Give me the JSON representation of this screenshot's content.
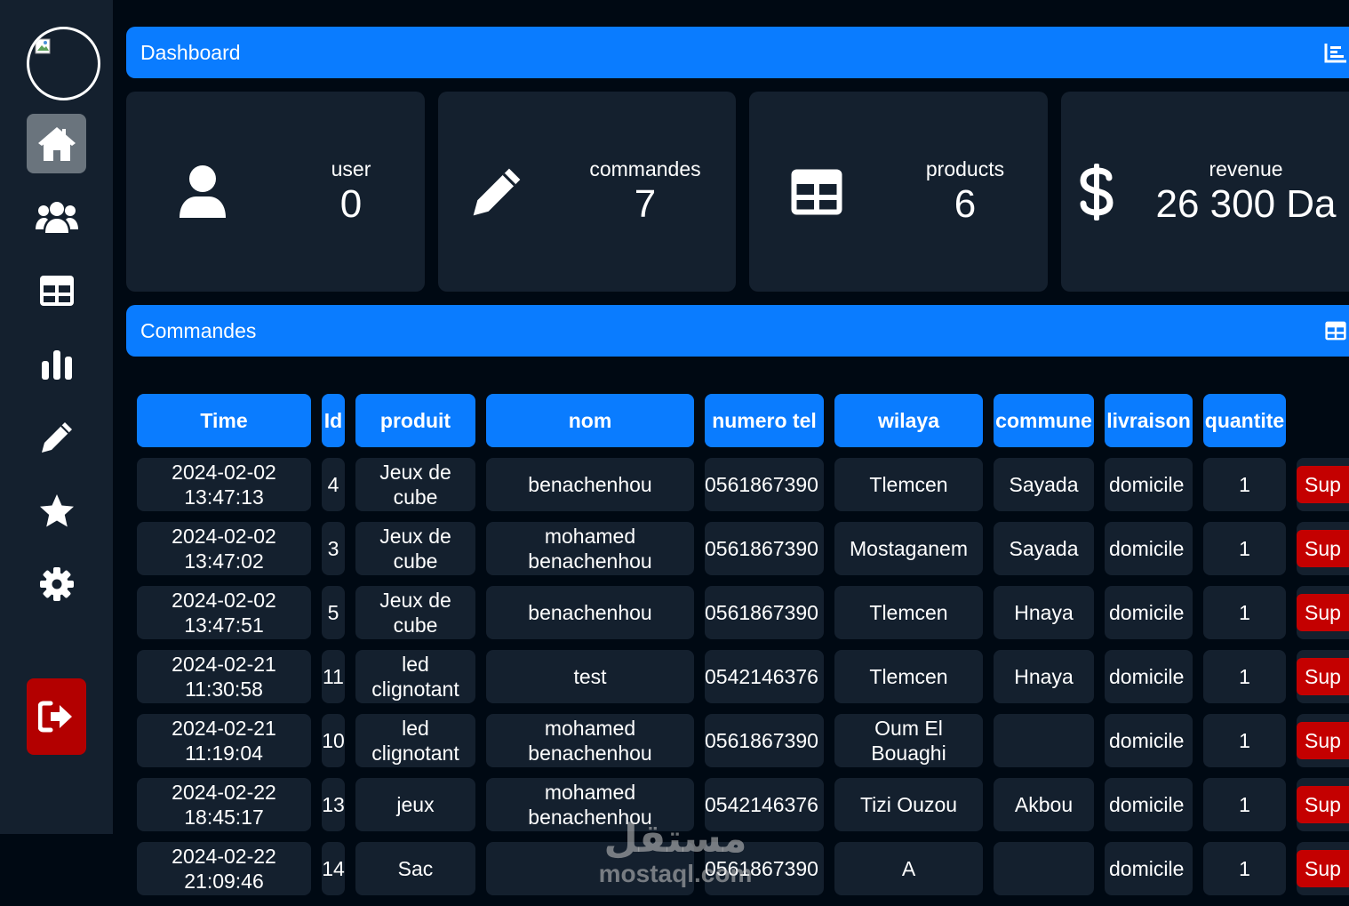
{
  "sidebar": {
    "items": [
      {
        "name": "home",
        "icon": "home-icon"
      },
      {
        "name": "users",
        "icon": "users-icon"
      },
      {
        "name": "table",
        "icon": "table-icon"
      },
      {
        "name": "chart",
        "icon": "chart-icon"
      },
      {
        "name": "edit",
        "icon": "pencil-icon"
      },
      {
        "name": "favorites",
        "icon": "star-icon"
      },
      {
        "name": "settings",
        "icon": "gear-icon"
      }
    ],
    "logout_icon": "logout-icon"
  },
  "header": {
    "title": "Dashboard",
    "icon": "chart-area-icon"
  },
  "stats": {
    "user": {
      "label": "user",
      "value": "0",
      "icon": "user-icon"
    },
    "commandes": {
      "label": "commandes",
      "value": "7",
      "icon": "pencil-icon"
    },
    "products": {
      "label": "products",
      "value": "6",
      "icon": "table-icon"
    },
    "revenue": {
      "label": "revenue",
      "value": "26 300 Da",
      "icon": "dollar-icon"
    }
  },
  "orders_section": {
    "title": "Commandes",
    "icon": "table-icon"
  },
  "table": {
    "headers": {
      "time": "Time",
      "id": "Id",
      "produit": "produit",
      "nom": "nom",
      "tel": "numero tel",
      "wilaya": "wilaya",
      "commune": "commune",
      "livraison": "livraison",
      "quantite": "quantite"
    },
    "delete_label": "Sup",
    "rows": [
      {
        "date": "2024-02-02",
        "time": "13:47:13",
        "id": "4",
        "produit": [
          "Jeux de",
          "cube"
        ],
        "nom": [
          "benachenhou"
        ],
        "tel": "0561867390",
        "wilaya": [
          "Tlemcen"
        ],
        "commune": "Sayada",
        "livraison": "domicile",
        "quantite": "1"
      },
      {
        "date": "2024-02-02",
        "time": "13:47:02",
        "id": "3",
        "produit": [
          "Jeux de",
          "cube"
        ],
        "nom": [
          "mohamed",
          "benachenhou"
        ],
        "tel": "0561867390",
        "wilaya": [
          "Mostaganem"
        ],
        "commune": "Sayada",
        "livraison": "domicile",
        "quantite": "1"
      },
      {
        "date": "2024-02-02",
        "time": "13:47:51",
        "id": "5",
        "produit": [
          "Jeux de",
          "cube"
        ],
        "nom": [
          "benachenhou"
        ],
        "tel": "0561867390",
        "wilaya": [
          "Tlemcen"
        ],
        "commune": "Hnaya",
        "livraison": "domicile",
        "quantite": "1"
      },
      {
        "date": "2024-02-21",
        "time": "11:30:58",
        "id": "11",
        "produit": [
          "led",
          "clignotant"
        ],
        "nom": [
          "test"
        ],
        "tel": "0542146376",
        "wilaya": [
          "Tlemcen"
        ],
        "commune": "Hnaya",
        "livraison": "domicile",
        "quantite": "1"
      },
      {
        "date": "2024-02-21",
        "time": "11:19:04",
        "id": "10",
        "produit": [
          "led",
          "clignotant"
        ],
        "nom": [
          "mohamed",
          "benachenhou"
        ],
        "tel": "0561867390",
        "wilaya": [
          "Oum El",
          "Bouaghi"
        ],
        "commune": "",
        "livraison": "domicile",
        "quantite": "1"
      },
      {
        "date": "2024-02-22",
        "time": "18:45:17",
        "id": "13",
        "produit": [
          "jeux"
        ],
        "nom": [
          "mohamed",
          "benachenhou"
        ],
        "tel": "0542146376",
        "wilaya": [
          "Tizi Ouzou"
        ],
        "commune": "Akbou",
        "livraison": "domicile",
        "quantite": "1"
      },
      {
        "date": "2024-02-22",
        "time": "21:09:46",
        "id": "14",
        "produit": [
          "Sac"
        ],
        "nom": [
          ""
        ],
        "tel": "0561867390",
        "wilaya": [
          "A"
        ],
        "commune": "",
        "livraison": "domicile",
        "quantite": "1"
      }
    ]
  },
  "watermark": {
    "arabic": "مستقل",
    "latin": "mostaql.com"
  },
  "colors": {
    "background": "#000913",
    "panel": "#14202e",
    "accent": "#0a7cff",
    "danger": "#c40000",
    "active_nav": "#6a747d"
  }
}
